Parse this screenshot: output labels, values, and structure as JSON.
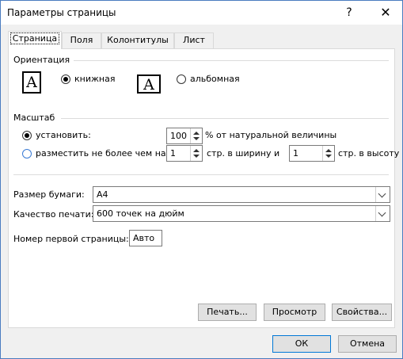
{
  "window": {
    "title": "Параметры страницы",
    "help_glyph": "?",
    "close_glyph": "✕"
  },
  "tabs": [
    "Страница",
    "Поля",
    "Колонтитулы",
    "Лист"
  ],
  "orientation": {
    "heading": "Ориентация",
    "portrait_label": "книжная",
    "landscape_label": "альбомная",
    "icon_letter": "A",
    "selected": "portrait"
  },
  "scale": {
    "heading": "Масштаб",
    "set_label": "установить:",
    "set_value": "100",
    "set_suffix": "% от натуральной величины",
    "fit_label": "разместить не более чем на:",
    "fit_width_value": "1",
    "fit_width_suffix": "стр. в ширину и",
    "fit_height_value": "1",
    "fit_height_suffix": "стр. в высоту",
    "selected": "set"
  },
  "paper": {
    "size_label": "Размер бумаги:",
    "size_value": "A4"
  },
  "quality": {
    "label": "Качество печати:",
    "value": "600 точек на дюйм"
  },
  "first_page": {
    "label": "Номер первой страницы:",
    "value": "Авто"
  },
  "buttons": {
    "print": "Печать...",
    "preview": "Просмотр",
    "properties": "Свойства...",
    "ok": "ОК",
    "cancel": "Отмена"
  },
  "colors": {
    "window_border": "#4a7cc0",
    "radio_accent": "#3a7bd5",
    "default_button_border": "#0078d7"
  }
}
